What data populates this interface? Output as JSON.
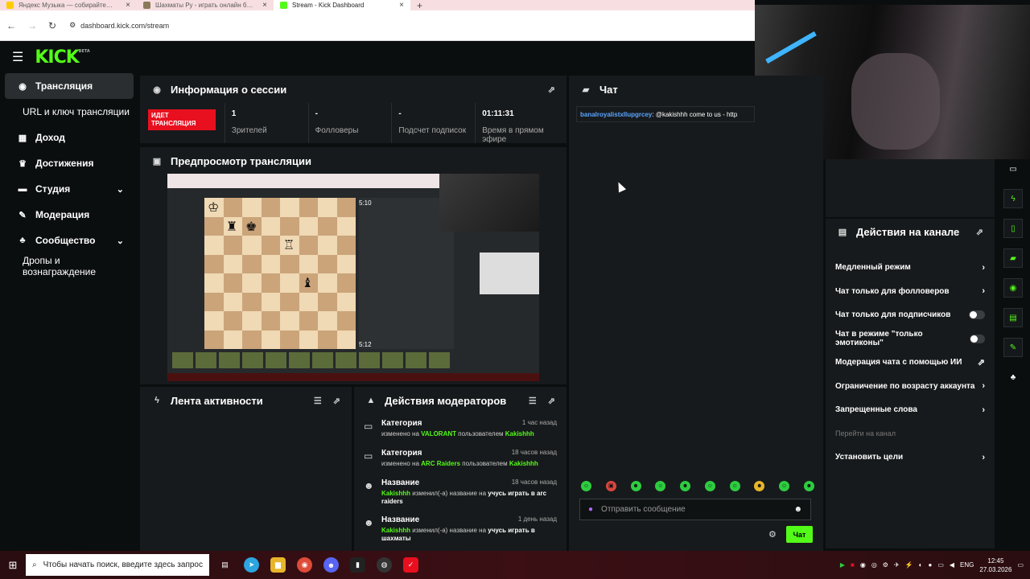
{
  "browser": {
    "tabs": [
      {
        "label": "Яндекс Музыка — собирайте…",
        "color": "#ffcc00",
        "active": false
      },
      {
        "label": "Шахматы Ру - играть онлайн б…",
        "color": "#8a7a5a",
        "active": false
      },
      {
        "label": "Stream - Kick Dashboard",
        "color": "#53fc18",
        "active": true
      }
    ],
    "url": "dashboard.kick.com/stream"
  },
  "brand": {
    "logo": "KICK",
    "badge": "BETA",
    "accent": "#53fc18"
  },
  "sidebar": {
    "items": [
      {
        "label": "Трансляция",
        "icon": "broadcast-icon",
        "active": true,
        "chevron": false,
        "sub": false
      },
      {
        "label": "URL и ключ трансляции",
        "icon": "",
        "active": false,
        "chevron": false,
        "sub": true
      },
      {
        "label": "Доход",
        "icon": "revenue-icon",
        "active": false,
        "chevron": false,
        "sub": false
      },
      {
        "label": "Достижения",
        "icon": "trophy-icon",
        "active": false,
        "chevron": false,
        "sub": false
      },
      {
        "label": "Студия",
        "icon": "studio-icon",
        "active": false,
        "chevron": true,
        "sub": false
      },
      {
        "label": "Модерация",
        "icon": "wrench-icon",
        "active": false,
        "chevron": false,
        "sub": false
      },
      {
        "label": "Сообщество",
        "icon": "community-icon",
        "active": false,
        "chevron": true,
        "sub": false
      },
      {
        "label": "Дропы и вознаграждение",
        "icon": "",
        "active": false,
        "chevron": false,
        "sub": true
      }
    ]
  },
  "session": {
    "title": "Информация о сессии",
    "live_badge": "ИДЕТ ТРАНСЛЯЦИЯ",
    "stats": [
      {
        "value": "1",
        "label": "Зрителей"
      },
      {
        "value": "-",
        "label": "Фолловеры"
      },
      {
        "value": "-",
        "label": "Подсчет подписок"
      },
      {
        "value": "01:11:31",
        "label": "Время в прямом эфире"
      }
    ]
  },
  "preview": {
    "title": "Предпросмотр трансляции",
    "clock_top": "5:10",
    "clock_bottom": "5:12"
  },
  "activity": {
    "title": "Лента активности"
  },
  "mod_actions": {
    "title": "Действия модераторов",
    "items": [
      {
        "type": "Категория",
        "ago": "1 час назад",
        "pre": "изменено на",
        "value": "VALORANT",
        "mid": "пользователем",
        "user": "Kakishhh",
        "icon": "category-icon"
      },
      {
        "type": "Категория",
        "ago": "18 часов назад",
        "pre": "изменено на",
        "value": "ARC Raiders",
        "mid": "пользователем",
        "user": "Kakishhh",
        "icon": "category-icon"
      },
      {
        "type": "Название",
        "ago": "18 часов назад",
        "user": "Kakishhh",
        "mid": "изменил(-а) название на",
        "value": "учусь играть в arc raiders",
        "icon": "user-edit-icon"
      },
      {
        "type": "Название",
        "ago": "1 день назад",
        "user": "Kakishhh",
        "mid": "изменил(-а) название на",
        "value": "учусь играть в шахматы",
        "icon": "user-edit-icon"
      }
    ]
  },
  "chat": {
    "title": "Чат",
    "message": {
      "user": "banalroyalistxllupgrcey",
      "text": ": @kakishhh come to us - http"
    },
    "input_placeholder": "Отправить сообщение",
    "send_label": "Чат"
  },
  "channel_actions": {
    "title": "Действия на канале",
    "items": [
      {
        "label": "Медленный режим",
        "kind": "chevron"
      },
      {
        "label": "Чат только для фолловеров",
        "kind": "chevron"
      },
      {
        "label": "Чат только для подписчиков",
        "kind": "toggle"
      },
      {
        "label": "Чат в режиме \"только эмотиконы\"",
        "kind": "toggle"
      },
      {
        "label": "Модерация чата с помощью ИИ",
        "kind": "external"
      },
      {
        "label": "Ограничение по возрасту аккаунта",
        "kind": "chevron"
      },
      {
        "label": "Запрещенные слова",
        "kind": "chevron"
      },
      {
        "label": "Перейти на канал",
        "kind": "dim"
      },
      {
        "label": "Установить цели",
        "kind": "chevron"
      }
    ]
  },
  "taskbar": {
    "search_placeholder": "Чтобы начать поиск, введите здесь запрос",
    "lang": "ENG",
    "time": "12:45",
    "date": "27.03.2026"
  }
}
